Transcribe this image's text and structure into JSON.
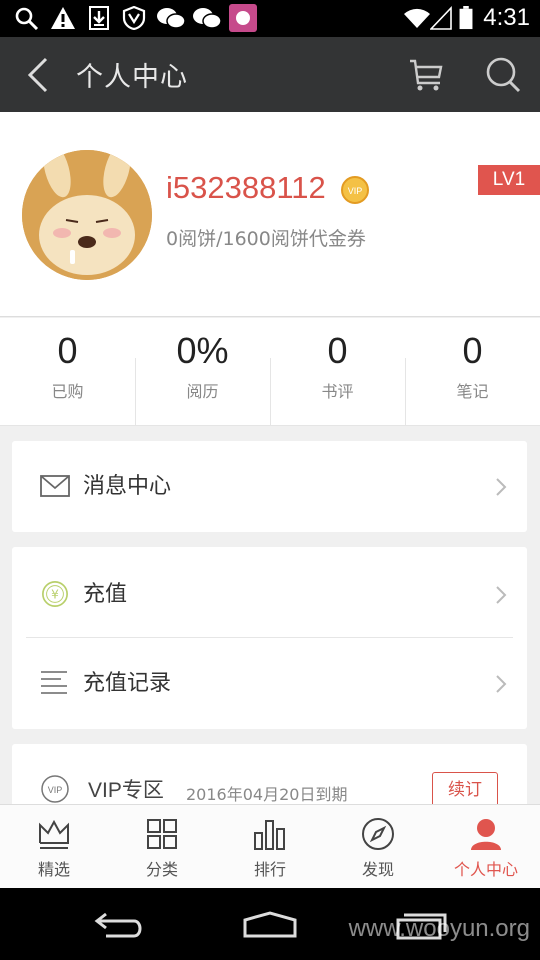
{
  "status_bar": {
    "time": "4:31"
  },
  "header": {
    "title": "个人中心"
  },
  "profile": {
    "username": "i532388112",
    "vip_badge": "VIP",
    "coupon_text": "0阅饼/1600阅饼代金券",
    "level": "LV1"
  },
  "stats": [
    {
      "value": "0",
      "label": "已购"
    },
    {
      "value": "0%",
      "label": "阅历"
    },
    {
      "value": "0",
      "label": "书评"
    },
    {
      "value": "0",
      "label": "笔记"
    }
  ],
  "menu": {
    "messages": "消息中心",
    "recharge": "充值",
    "recharge_records": "充值记录",
    "vip_label": "VIP专区",
    "vip_expiry": "2016年04月20日到期",
    "renew": "续订"
  },
  "tabs": [
    {
      "label": "精选",
      "icon": "crown-icon"
    },
    {
      "label": "分类",
      "icon": "grid-icon"
    },
    {
      "label": "排行",
      "icon": "bar-chart-icon"
    },
    {
      "label": "发现",
      "icon": "compass-icon"
    },
    {
      "label": "个人中心",
      "icon": "person-icon"
    }
  ],
  "watermark": "www.wooyun.org",
  "colors": {
    "accent": "#e0554e",
    "header_bg": "#333435",
    "avatar_bg": "#d9a354"
  }
}
